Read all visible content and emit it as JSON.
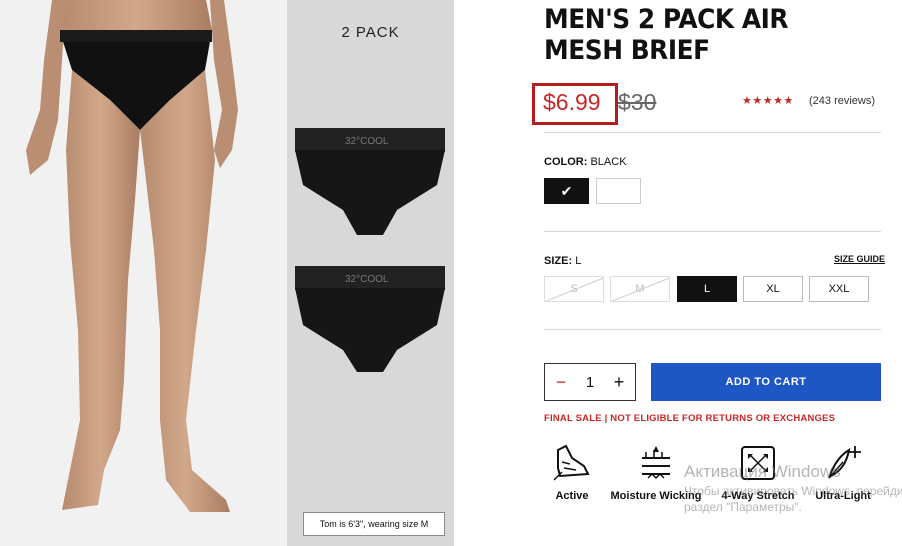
{
  "gallery": {
    "pack_label": "2 PACK",
    "caption": "Tom is 6'3\", wearing size M"
  },
  "product": {
    "title": "MEN'S 2 PACK AIR MESH BRIEF",
    "price_sale": "$6.99",
    "price_original": "$30",
    "rating_stars": 5,
    "reviews": "(243 reviews)"
  },
  "color": {
    "label": "COLOR:",
    "value": "BLACK",
    "swatches": [
      "#111111",
      "#ffffff"
    ]
  },
  "size": {
    "label": "SIZE:",
    "value": "L",
    "guide": "SIZE GUIDE",
    "options": [
      "S",
      "M",
      "L",
      "XL",
      "XXL"
    ]
  },
  "cart": {
    "quantity": "1",
    "add_label": "ADD TO CART"
  },
  "notice": "FINAL SALE | NOT ELIGIBLE FOR RETURNS OR EXCHANGES",
  "features": [
    "Active",
    "Moisture Wicking",
    "4-Way Stretch",
    "Ultra-Light"
  ],
  "watermark": {
    "title": "Активация Windows",
    "line1": "Чтобы активировать Windows, перейдите в",
    "line2": "раздел \"Параметры\"."
  },
  "colors": {
    "accent_red": "#c62828",
    "button_blue": "#1e56c4"
  }
}
